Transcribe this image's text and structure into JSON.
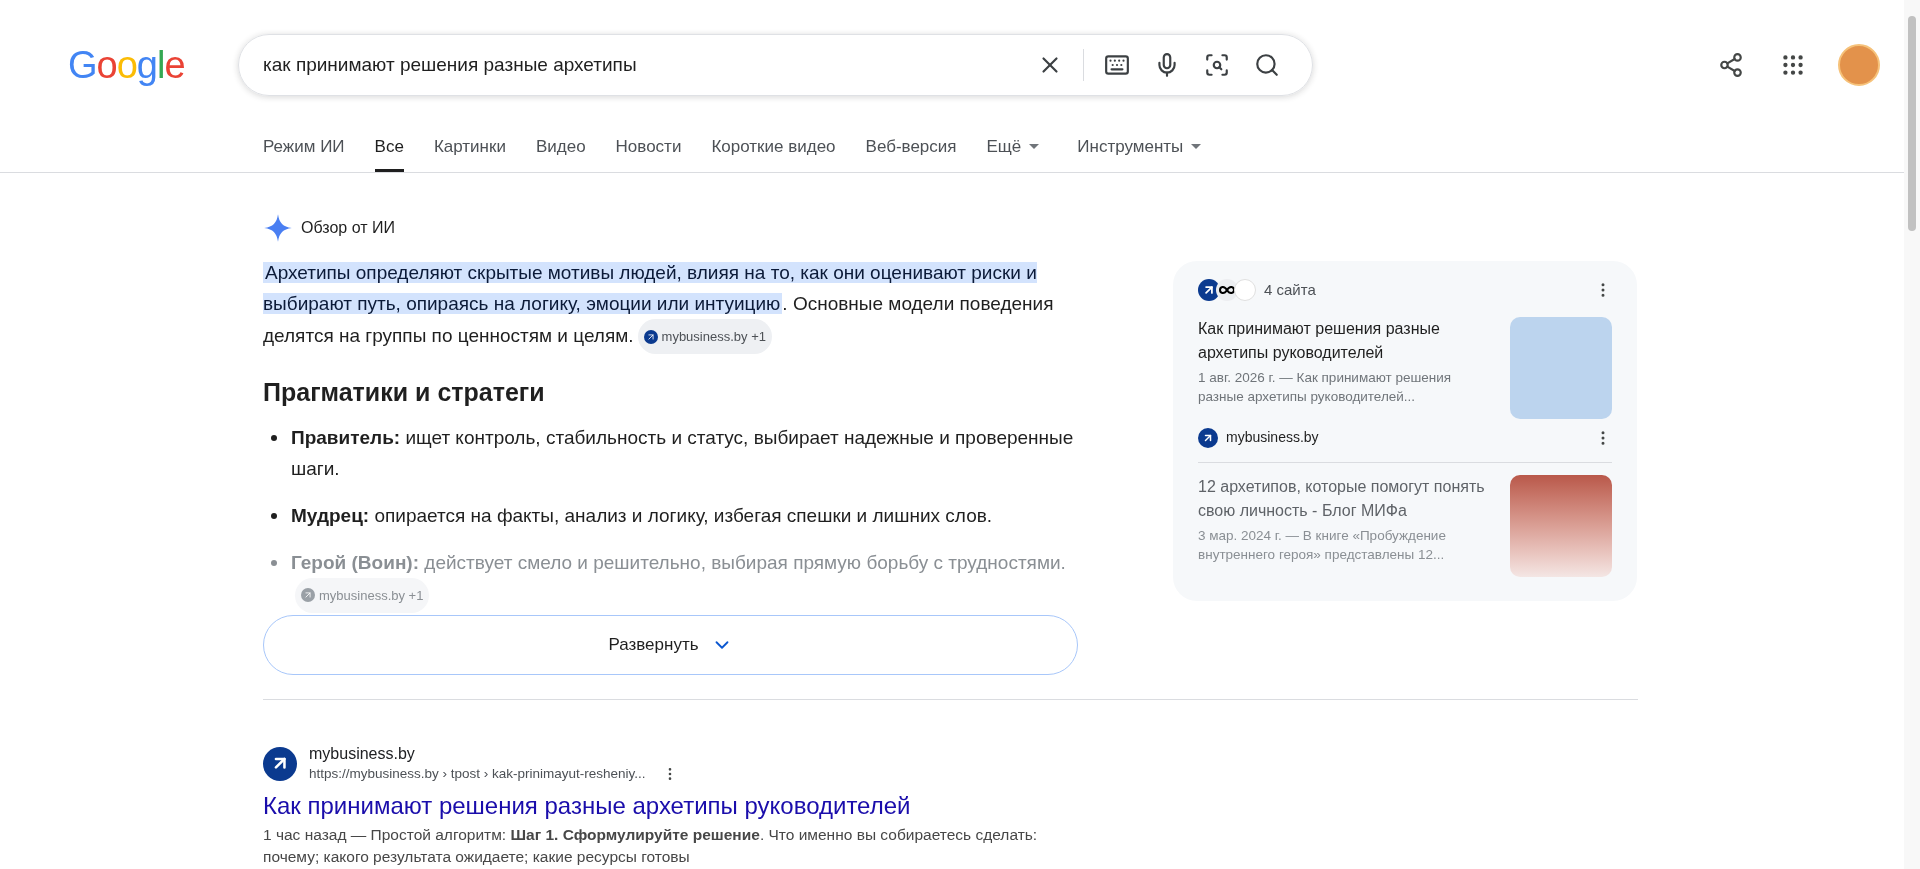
{
  "logo": "Google",
  "search": {
    "value": "как принимают решения разные архетипы"
  },
  "tabs": [
    {
      "label": "Режим ИИ",
      "selected": false,
      "kind": "plain"
    },
    {
      "label": "Все",
      "selected": true,
      "kind": "plain"
    },
    {
      "label": "Картинки",
      "selected": false,
      "kind": "plain"
    },
    {
      "label": "Видео",
      "selected": false,
      "kind": "plain"
    },
    {
      "label": "Новости",
      "selected": false,
      "kind": "plain"
    },
    {
      "label": "Короткие видео",
      "selected": false,
      "kind": "plain"
    },
    {
      "label": "Веб-версия",
      "selected": false,
      "kind": "plain"
    },
    {
      "label": "Ещё",
      "selected": false,
      "kind": "dropdown"
    },
    {
      "label": "Инструменты",
      "selected": false,
      "kind": "dropdown"
    }
  ],
  "ai_overview": {
    "title": "Обзор от ИИ",
    "summary_highlighted": "Архетипы определяют скрытые мотивы людей, влияя на то, как они оценивают риски и выбирают путь, опираясь на логику, эмоции или интуицию",
    "summary_rest": ". Основные модели поведения делятся на группы по ценностям и целям.",
    "summary_source": "mybusiness.by +1",
    "heading": "Прагматики и стратеги",
    "bullets": [
      {
        "text": "**Правитель:** ищет контроль, стабильность и статус, выбирает надежные и проверенные шаги.",
        "faded": false
      },
      {
        "text": "**Мудрец:** опирается на факты, анализ и логику, избегая спешки и лишних слов.",
        "faded": false
      },
      {
        "text": "**Герой (Воин):** действует смело и решительно, выбирая прямую борьбу с трудностями.",
        "faded": true,
        "source": "mybusiness.by +1"
      }
    ],
    "expand_button": "Развернуть",
    "sources": {
      "count": "4 сайта",
      "items": [
        {
          "title": "Как принимают решения разные архетипы руководителей",
          "snippet": "1 авг. 2026 г. — Как принимают решения разные архетипы руководителей...",
          "site": "mybusiness.by",
          "faded": false
        },
        {
          "title": "12 архетипов, которые помогут понять свою личность - Блог МИФа",
          "snippet": "3 мар. 2024 г. — В книге «Пробуждение внутреннего героя» представлены 12...",
          "faded": true
        }
      ]
    }
  },
  "results": [
    {
      "site": "mybusiness.by",
      "url": "https://mybusiness.by › tpost › kak-prinimayut-resheniy...",
      "title": "Как принимают решения разные архетипы руководителей",
      "snippet": "1 час назад — Простой алгоритм: **Шаг 1. Сформулируйте решение**. Что именно вы собираетесь сделать: почему; какого результата ожидаете; какие ресурсы готовы"
    }
  ]
}
